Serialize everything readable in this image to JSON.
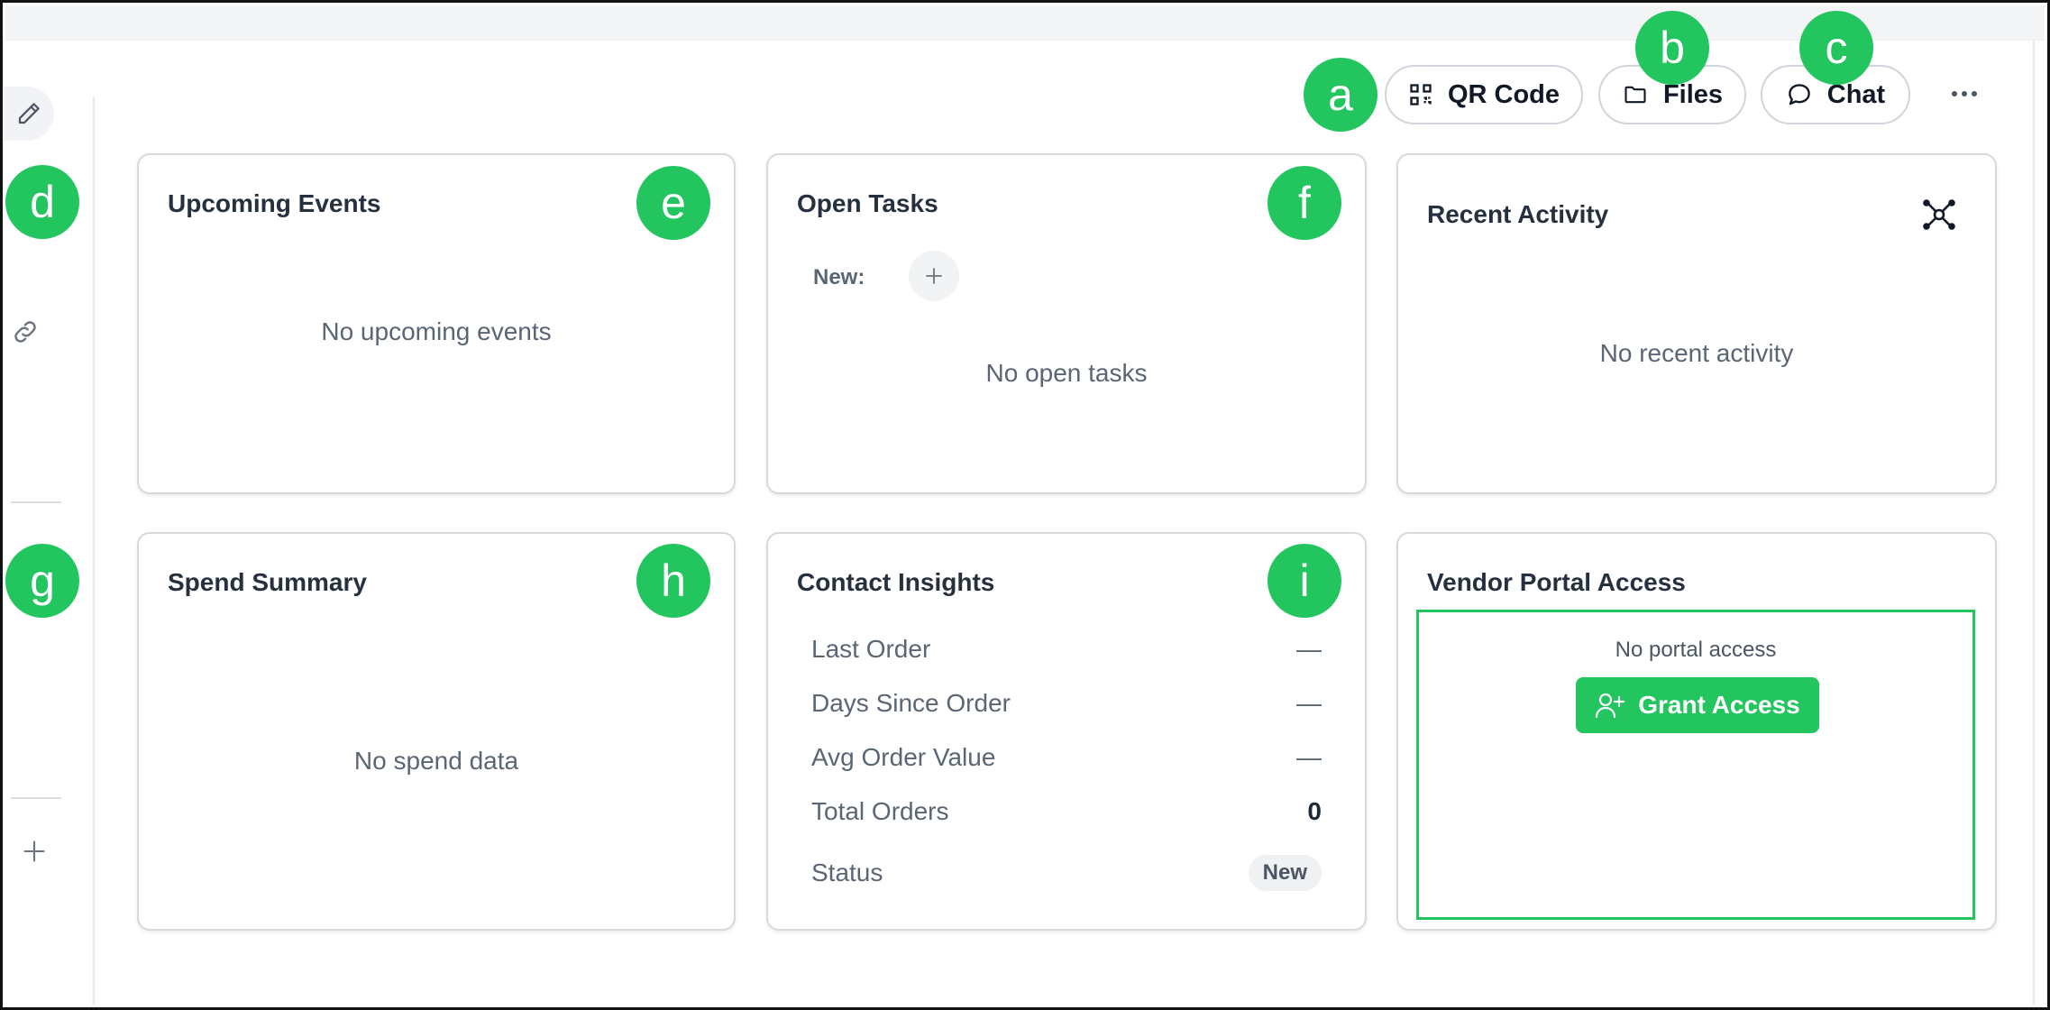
{
  "toolbar": {
    "qr_label": "QR Code",
    "files_label": "Files",
    "chat_label": "Chat"
  },
  "badges": {
    "a": "a",
    "b": "b",
    "c": "c",
    "d": "d",
    "e": "e",
    "f": "f",
    "g": "g",
    "h": "h",
    "i": "i"
  },
  "cards": {
    "upcoming_events": {
      "title": "Upcoming Events",
      "empty": "No upcoming events"
    },
    "open_tasks": {
      "title": "Open Tasks",
      "new_label": "New:",
      "empty": "No open tasks"
    },
    "recent_activity": {
      "title": "Recent Activity",
      "empty": "No recent activity"
    },
    "spend_summary": {
      "title": "Spend Summary",
      "empty": "No spend data"
    },
    "contact_insights": {
      "title": "Contact Insights",
      "rows": [
        {
          "label": "Last Order",
          "value": "—"
        },
        {
          "label": "Days Since Order",
          "value": "—"
        },
        {
          "label": "Avg Order Value",
          "value": "—"
        },
        {
          "label": "Total Orders",
          "value": "0"
        },
        {
          "label": "Status",
          "value": "New"
        }
      ]
    },
    "vendor_portal": {
      "title": "Vendor Portal Access",
      "status_text": "No portal access",
      "grant_label": "Grant Access"
    }
  },
  "colors": {
    "accent_green": "#22c55e",
    "text_dark": "#27303f",
    "text_muted": "#5b6675"
  },
  "icons": {
    "qr": "qr-code-icon",
    "files": "folder-icon",
    "chat": "chat-bubble-icon",
    "more": "more-horizontal-icon",
    "edit": "pencil-icon",
    "link": "link-icon",
    "add": "plus-icon",
    "activity": "network-icon",
    "grant": "user-plus-icon"
  }
}
